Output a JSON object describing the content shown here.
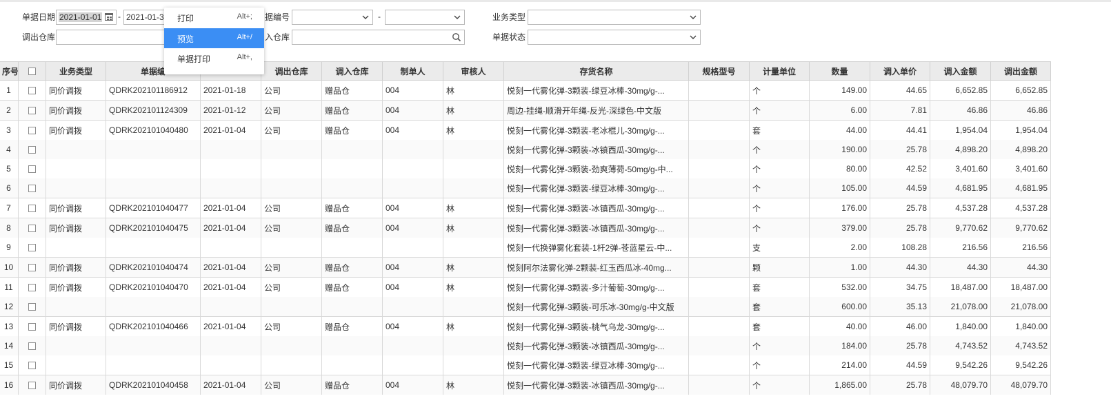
{
  "filters": {
    "date_label": "单据日期",
    "date_from": "2021-01-01",
    "date_to": "2021-01-3",
    "range_dash": "-",
    "docno_label": "据编号",
    "biztype_label": "业务类型",
    "out_wh_label": "调出仓库",
    "in_wh_label": "入仓库",
    "status_label": "单据状态"
  },
  "menu": {
    "items": [
      {
        "label": "打印",
        "shortcut": "Alt+;"
      },
      {
        "label": "预览",
        "shortcut": "Alt+/"
      },
      {
        "label": "单据打印",
        "shortcut": "Alt+,"
      }
    ]
  },
  "table": {
    "headers": [
      "序号",
      "",
      "业务类型",
      "单据编",
      "",
      "调出仓库",
      "调入仓库",
      "制单人",
      "审核人",
      "存货名称",
      "规格型号",
      "计量单位",
      "数量",
      "调入单价",
      "调入金额",
      "调出金额"
    ],
    "rows": [
      {
        "no": "1",
        "type": "同价调拨",
        "docno": "QDRK202101186912",
        "date": "2021-01-18",
        "out": "公司",
        "in": "赠品仓",
        "maker": "004",
        "auditor": "林",
        "item": "悦刻一代雾化弹-3颗装-绿豆冰棒-30mg/g-...",
        "spec": "",
        "unit": "个",
        "qty": "149.00",
        "price": "44.65",
        "in_amt": "6,652.85",
        "out_amt": "6,652.85"
      },
      {
        "no": "2",
        "type": "同价调拨",
        "docno": "QDRK202101124309",
        "date": "2021-01-12",
        "out": "公司",
        "in": "赠品仓",
        "maker": "004",
        "auditor": "林",
        "item": "周边-挂绳-顺滑开年绳-反光-深绿色-中文版",
        "spec": "",
        "unit": "个",
        "qty": "6.00",
        "price": "7.81",
        "in_amt": "46.86",
        "out_amt": "46.86"
      },
      {
        "no": "3",
        "type": "同价调拨",
        "docno": "QDRK202101040480",
        "date": "2021-01-04",
        "out": "公司",
        "in": "赠品仓",
        "maker": "004",
        "auditor": "林",
        "item": "悦刻一代雾化弹-3颗装-老冰棍儿-30mg/g-...",
        "spec": "",
        "unit": "套",
        "qty": "44.00",
        "price": "44.41",
        "in_amt": "1,954.04",
        "out_amt": "1,954.04"
      },
      {
        "no": "4",
        "type": "",
        "docno": "",
        "date": "",
        "out": "",
        "in": "",
        "maker": "",
        "auditor": "",
        "item": "悦刻一代雾化弹-3颗装-冰镇西瓜-30mg/g-...",
        "spec": "",
        "unit": "个",
        "qty": "190.00",
        "price": "25.78",
        "in_amt": "4,898.20",
        "out_amt": "4,898.20"
      },
      {
        "no": "5",
        "type": "",
        "docno": "",
        "date": "",
        "out": "",
        "in": "",
        "maker": "",
        "auditor": "",
        "item": "悦刻一代雾化弹-3颗装-劲爽薄荷-50mg/g-中...",
        "spec": "",
        "unit": "个",
        "qty": "80.00",
        "price": "42.52",
        "in_amt": "3,401.60",
        "out_amt": "3,401.60"
      },
      {
        "no": "6",
        "type": "",
        "docno": "",
        "date": "",
        "out": "",
        "in": "",
        "maker": "",
        "auditor": "",
        "item": "悦刻一代雾化弹-3颗装-绿豆冰棒-30mg/g-...",
        "spec": "",
        "unit": "个",
        "qty": "105.00",
        "price": "44.59",
        "in_amt": "4,681.95",
        "out_amt": "4,681.95"
      },
      {
        "no": "7",
        "type": "同价调拨",
        "docno": "QDRK202101040477",
        "date": "2021-01-04",
        "out": "公司",
        "in": "赠品仓",
        "maker": "004",
        "auditor": "林",
        "item": "悦刻一代雾化弹-3颗装-冰镇西瓜-30mg/g-...",
        "spec": "",
        "unit": "个",
        "qty": "176.00",
        "price": "25.78",
        "in_amt": "4,537.28",
        "out_amt": "4,537.28"
      },
      {
        "no": "8",
        "type": "同价调拨",
        "docno": "QDRK202101040475",
        "date": "2021-01-04",
        "out": "公司",
        "in": "赠品仓",
        "maker": "004",
        "auditor": "林",
        "item": "悦刻一代雾化弹-3颗装-冰镇西瓜-30mg/g-...",
        "spec": "",
        "unit": "个",
        "qty": "379.00",
        "price": "25.78",
        "in_amt": "9,770.62",
        "out_amt": "9,770.62"
      },
      {
        "no": "9",
        "type": "",
        "docno": "",
        "date": "",
        "out": "",
        "in": "",
        "maker": "",
        "auditor": "",
        "item": "悦刻一代换弹雾化套装-1杆2弹-苍蓝星云-中...",
        "spec": "",
        "unit": "支",
        "qty": "2.00",
        "price": "108.28",
        "in_amt": "216.56",
        "out_amt": "216.56"
      },
      {
        "no": "10",
        "type": "同价调拨",
        "docno": "QDRK202101040474",
        "date": "2021-01-04",
        "out": "公司",
        "in": "赠品仓",
        "maker": "004",
        "auditor": "林",
        "item": "悦刻阿尔法雾化弹-2颗装-红玉西瓜冰-40mg...",
        "spec": "",
        "unit": "颗",
        "qty": "1.00",
        "price": "44.30",
        "in_amt": "44.30",
        "out_amt": "44.30"
      },
      {
        "no": "11",
        "type": "同价调拨",
        "docno": "QDRK202101040470",
        "date": "2021-01-04",
        "out": "公司",
        "in": "赠品仓",
        "maker": "004",
        "auditor": "林",
        "item": "悦刻一代雾化弹-3颗装-多汁葡萄-30mg/g-...",
        "spec": "",
        "unit": "套",
        "qty": "532.00",
        "price": "34.75",
        "in_amt": "18,487.00",
        "out_amt": "18,487.00"
      },
      {
        "no": "12",
        "type": "",
        "docno": "",
        "date": "",
        "out": "",
        "in": "",
        "maker": "",
        "auditor": "",
        "item": "悦刻一代雾化弹-3颗装-可乐冰-30mg/g-中文版",
        "spec": "",
        "unit": "套",
        "qty": "600.00",
        "price": "35.13",
        "in_amt": "21,078.00",
        "out_amt": "21,078.00"
      },
      {
        "no": "13",
        "type": "同价调拨",
        "docno": "QDRK202101040466",
        "date": "2021-01-04",
        "out": "公司",
        "in": "赠品仓",
        "maker": "004",
        "auditor": "林",
        "item": "悦刻一代雾化弹-3颗装-桃气乌龙-30mg/g-...",
        "spec": "",
        "unit": "套",
        "qty": "40.00",
        "price": "46.00",
        "in_amt": "1,840.00",
        "out_amt": "1,840.00"
      },
      {
        "no": "14",
        "type": "",
        "docno": "",
        "date": "",
        "out": "",
        "in": "",
        "maker": "",
        "auditor": "",
        "item": "悦刻一代雾化弹-3颗装-冰镇西瓜-30mg/g-...",
        "spec": "",
        "unit": "个",
        "qty": "184.00",
        "price": "25.78",
        "in_amt": "4,743.52",
        "out_amt": "4,743.52"
      },
      {
        "no": "15",
        "type": "",
        "docno": "",
        "date": "",
        "out": "",
        "in": "",
        "maker": "",
        "auditor": "",
        "item": "悦刻一代雾化弹-3颗装-绿豆冰棒-30mg/g-...",
        "spec": "",
        "unit": "个",
        "qty": "214.00",
        "price": "44.59",
        "in_amt": "9,542.26",
        "out_amt": "9,542.26"
      },
      {
        "no": "16",
        "type": "同价调拨",
        "docno": "QDRK202101040458",
        "date": "2021-01-04",
        "out": "公司",
        "in": "赠品仓",
        "maker": "004",
        "auditor": "林",
        "item": "悦刻一代雾化弹-3颗装-冰镇西瓜-30mg/g-...",
        "spec": "",
        "unit": "个",
        "qty": "1,865.00",
        "price": "25.78",
        "in_amt": "48,079.70",
        "out_amt": "48,079.70"
      }
    ]
  }
}
